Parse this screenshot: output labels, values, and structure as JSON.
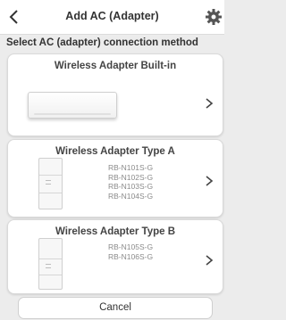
{
  "header": {
    "title": "Add AC (Adapter)"
  },
  "subtitle": "Select AC (adapter) connection method",
  "options": [
    {
      "title": "Wireless Adapter Built-in",
      "models": []
    },
    {
      "title": "Wireless Adapter Type A",
      "models": [
        "RB-N101S-G",
        "RB-N102S-G",
        "RB-N103S-G",
        "RB-N104S-G"
      ]
    },
    {
      "title": "Wireless Adapter Type B",
      "models": [
        "RB-N105S-G",
        "RB-N106S-G"
      ]
    }
  ],
  "cancel_label": "Cancel",
  "icons": {
    "back": "chevron-left-icon",
    "settings": "gear-icon",
    "next": "chevron-right-icon"
  }
}
